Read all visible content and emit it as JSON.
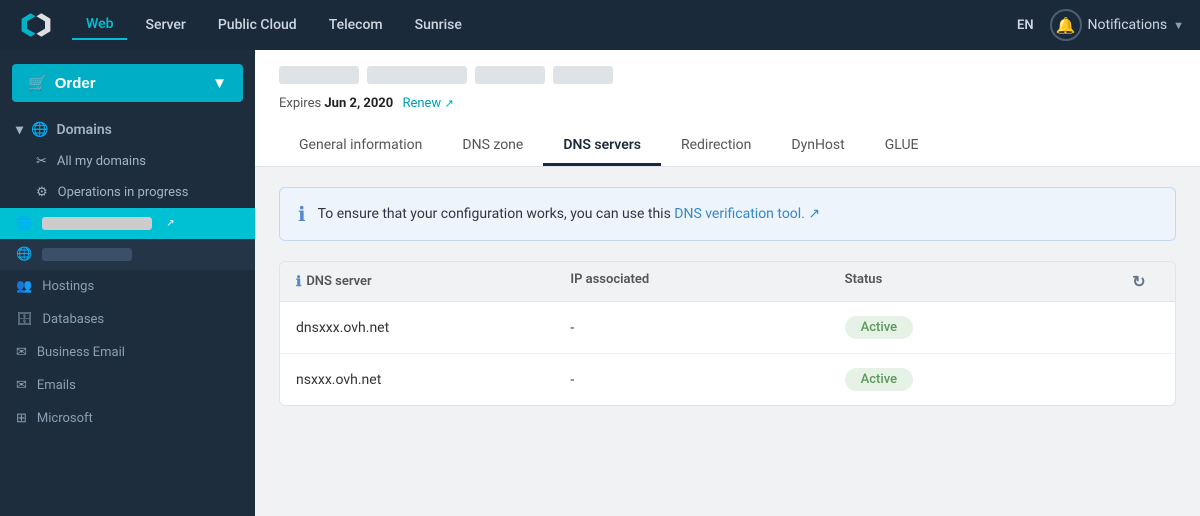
{
  "topnav": {
    "logo_alt": "OVH Logo",
    "links": [
      {
        "label": "Web",
        "active": true
      },
      {
        "label": "Server",
        "active": false
      },
      {
        "label": "Public Cloud",
        "active": false
      },
      {
        "label": "Telecom",
        "active": false
      },
      {
        "label": "Sunrise",
        "active": false
      }
    ],
    "lang": "EN",
    "notifications_label": "Notifications"
  },
  "sidebar": {
    "order_label": "Order",
    "sections": [
      {
        "label": "Domains",
        "icon": "🌐",
        "items": [
          {
            "label": "All my domains",
            "icon": "✂",
            "active": false
          },
          {
            "label": "Operations in progress",
            "icon": "⚙",
            "active": false
          }
        ]
      }
    ],
    "domain_items": [
      {
        "label": "blurred-domain-1",
        "active": true
      },
      {
        "label": "blurred-domain-2",
        "active": false
      }
    ],
    "group_items": [
      {
        "label": "Hostings",
        "icon": "👥"
      },
      {
        "label": "Databases",
        "icon": "🗄"
      },
      {
        "label": "Business Email",
        "icon": "✉"
      },
      {
        "label": "Emails",
        "icon": "✉"
      },
      {
        "label": "Microsoft",
        "icon": "⊞"
      }
    ]
  },
  "domain_header": {
    "expiry_prefix": "Expires",
    "expiry_date": "Jun 2, 2020",
    "renew_label": "Renew"
  },
  "tabs": [
    {
      "label": "General information",
      "active": false
    },
    {
      "label": "DNS zone",
      "active": false
    },
    {
      "label": "DNS servers",
      "active": true
    },
    {
      "label": "Redirection",
      "active": false
    },
    {
      "label": "DynHost",
      "active": false
    },
    {
      "label": "GLUE",
      "active": false
    }
  ],
  "info_banner": {
    "text_prefix": "To ensure that your configuration works, you can use this",
    "link_label": "DNS verification tool.",
    "link_icon": "↗"
  },
  "dns_table": {
    "headers": [
      {
        "label": "DNS server",
        "has_info": true
      },
      {
        "label": "IP associated"
      },
      {
        "label": "Status"
      }
    ],
    "rows": [
      {
        "server": "dnsxxx.ovh.net",
        "ip": "-",
        "status": "Active"
      },
      {
        "server": "nsxxx.ovh.net",
        "ip": "-",
        "status": "Active"
      }
    ]
  }
}
